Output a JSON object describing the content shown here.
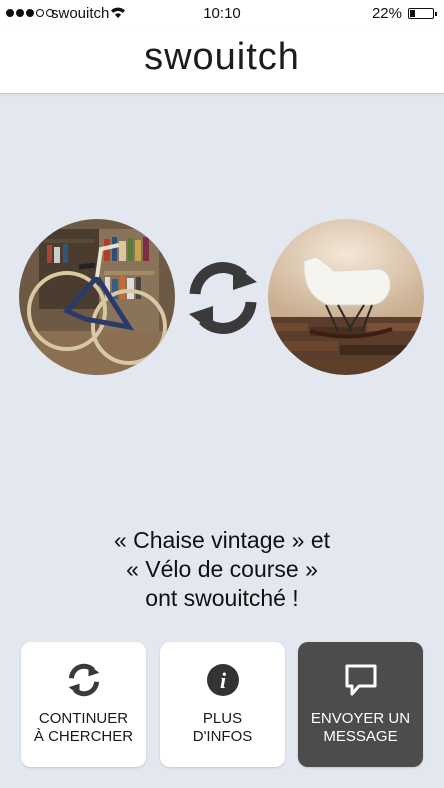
{
  "status_bar": {
    "carrier": "swouitch",
    "time": "10:10",
    "battery": "22%",
    "battery_level": 0.22,
    "signal_bars": 3,
    "signal_total": 5
  },
  "header": {
    "logo": "swouitch"
  },
  "match": {
    "left_item_image": "bicycle-photo",
    "swap_icon": "swap-arrows-icon",
    "right_item_image": "rocking-chair-photo"
  },
  "message": {
    "line1": "« Chaise vintage » et",
    "line2": "« Vélo de course »",
    "line3": "ont swouitché !"
  },
  "actions": {
    "continue": {
      "icon": "refresh-icon",
      "line1": "CONTINUER",
      "line2": "À CHERCHER"
    },
    "infos": {
      "icon": "info-icon",
      "line1": "PLUS",
      "line2": "D'INFOS"
    },
    "message": {
      "icon": "chat-bubble-icon",
      "line1": "ENVOYER UN",
      "line2": "MESSAGE"
    }
  },
  "colors": {
    "background": "#e3e8f0",
    "dark_button": "#4c4c4c",
    "icon_dark": "#3a3a3a"
  }
}
